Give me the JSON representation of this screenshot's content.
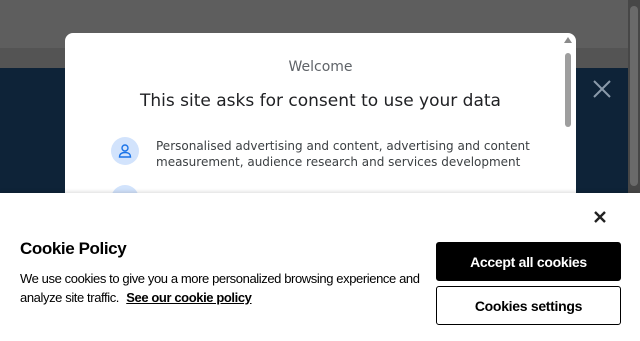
{
  "consent_dialog": {
    "welcome": "Welcome",
    "title": "This site asks for consent to use your data",
    "purposes": [
      {
        "icon": "person-icon",
        "text": "Personalised advertising and content, advertising and content measurement, audience research and services development"
      }
    ]
  },
  "cookie_banner": {
    "title": "Cookie Policy",
    "text": "We use cookies to give you a more personalized browsing experience and analyze site traffic.",
    "link_label": "See our cookie policy",
    "accept_label": "Accept all cookies",
    "settings_label": "Cookies settings"
  },
  "colors": {
    "overlay": "#5b5b5b",
    "hero_background": "#0e2338",
    "purpose_icon_bg": "#d2e3fc",
    "primary_button": "#000000"
  }
}
